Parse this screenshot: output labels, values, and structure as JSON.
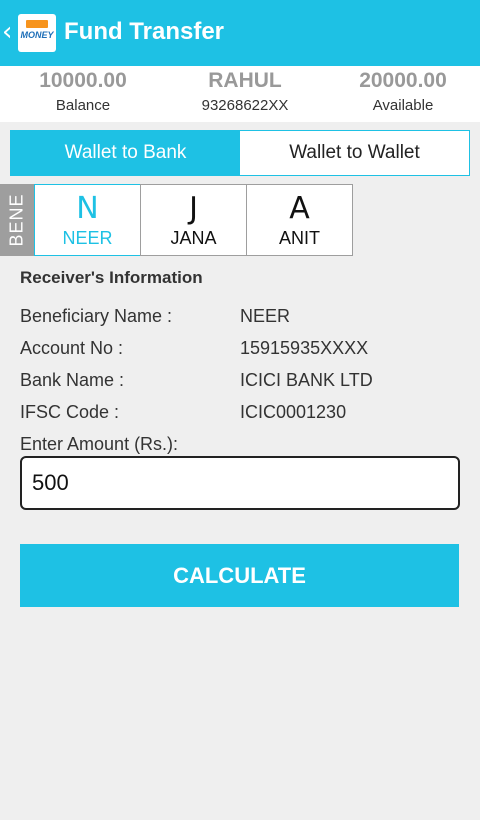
{
  "header": {
    "back_glyph": "‹",
    "logo_text": "MONEY",
    "title": "Fund Transfer"
  },
  "summary": {
    "balance_value": "10000.00",
    "balance_label": "Balance",
    "user_name": "RAHUL",
    "user_phone": "93268622XX",
    "available_value": "20000.00",
    "available_label": "Available"
  },
  "tabs": [
    {
      "label": "Wallet to Bank",
      "active": true
    },
    {
      "label": "Wallet to Wallet",
      "active": false
    }
  ],
  "beneficiaries": {
    "side_label": "BENE",
    "items": [
      {
        "initial": "N",
        "name": "NEER",
        "selected": true
      },
      {
        "initial": "J",
        "name": "JANA",
        "selected": false
      },
      {
        "initial": "A",
        "name": "ANIT",
        "selected": false
      }
    ]
  },
  "receiver": {
    "section_title": "Receiver's Information",
    "rows": [
      {
        "label": "Beneficiary Name :",
        "value": "NEER"
      },
      {
        "label": "Account No :",
        "value": "15915935XXXX"
      },
      {
        "label": "Bank Name :",
        "value": "ICICI BANK LTD"
      },
      {
        "label": "IFSC Code :",
        "value": "ICIC0001230"
      }
    ],
    "amount_label": "Enter Amount (Rs.):",
    "amount_value": "500"
  },
  "actions": {
    "calculate_label": "CALCULATE"
  },
  "colors": {
    "accent": "#1ec1e4",
    "background": "#efefef",
    "bene_label_bg": "#9e9e9e"
  }
}
